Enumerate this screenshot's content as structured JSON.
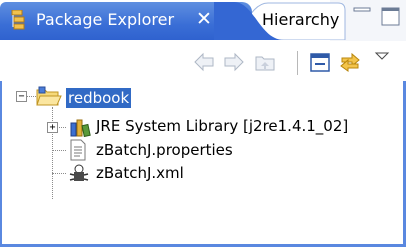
{
  "tabs": {
    "active_label": "Package Explorer",
    "close_symbol": "✕",
    "inactive_label": "Hierarchy"
  },
  "toolbar": {
    "icons": [
      "back-arrow-icon",
      "forward-arrow-icon",
      "up-folder-icon",
      "collapse-all-icon",
      "link-with-editor-icon",
      "view-menu-icon"
    ]
  },
  "tree": {
    "root": {
      "label": "redbook",
      "expanded": true,
      "selected": true
    },
    "children": [
      {
        "label": "JRE System Library [j2re1.4.1_02]",
        "icon": "library-icon",
        "expandable": true
      },
      {
        "label": "zBatchJ.properties",
        "icon": "properties-file-icon",
        "expandable": false
      },
      {
        "label": "zBatchJ.xml",
        "icon": "xml-file-icon",
        "expandable": false
      }
    ]
  },
  "colors": {
    "active_tab": "#3a6ed6",
    "selection": "#316ac5",
    "border": "#5a88e0"
  }
}
